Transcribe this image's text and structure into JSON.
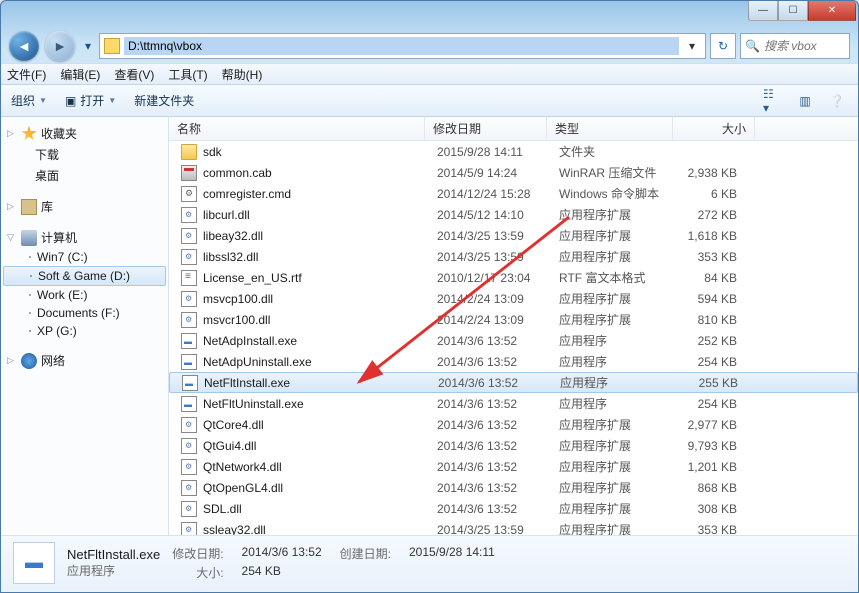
{
  "address_path": "D:\\ttmnq\\vbox",
  "search_placeholder": "搜索 vbox",
  "menu": {
    "file": "文件(F)",
    "edit": "编辑(E)",
    "view": "查看(V)",
    "tools": "工具(T)",
    "help": "帮助(H)"
  },
  "toolbar": {
    "organize": "组织",
    "open": "打开",
    "newfolder": "新建文件夹"
  },
  "sidebar": {
    "favorites": {
      "label": "收藏夹",
      "items": [
        {
          "label": "下载"
        },
        {
          "label": "桌面"
        }
      ]
    },
    "libraries": {
      "label": "库"
    },
    "computer": {
      "label": "计算机",
      "drives": [
        {
          "label": "Win7 (C:)"
        },
        {
          "label": "Soft & Game (D:)"
        },
        {
          "label": "Work (E:)"
        },
        {
          "label": "Documents (F:)"
        },
        {
          "label": "XP (G:)"
        }
      ]
    },
    "network": {
      "label": "网络"
    }
  },
  "columns": {
    "name": "名称",
    "date": "修改日期",
    "type": "类型",
    "size": "大小"
  },
  "files": [
    {
      "icon": "folder",
      "name": "sdk",
      "date": "2015/9/28 14:11",
      "type": "文件夹",
      "size": ""
    },
    {
      "icon": "cab",
      "name": "common.cab",
      "date": "2014/5/9 14:24",
      "type": "WinRAR 压缩文件",
      "size": "2,938 KB"
    },
    {
      "icon": "cmd",
      "name": "comregister.cmd",
      "date": "2014/12/24 15:28",
      "type": "Windows 命令脚本",
      "size": "6 KB"
    },
    {
      "icon": "dll",
      "name": "libcurl.dll",
      "date": "2014/5/12 14:10",
      "type": "应用程序扩展",
      "size": "272 KB"
    },
    {
      "icon": "dll",
      "name": "libeay32.dll",
      "date": "2014/3/25 13:59",
      "type": "应用程序扩展",
      "size": "1,618 KB"
    },
    {
      "icon": "dll",
      "name": "libssl32.dll",
      "date": "2014/3/25 13:59",
      "type": "应用程序扩展",
      "size": "353 KB"
    },
    {
      "icon": "rtf",
      "name": "License_en_US.rtf",
      "date": "2010/12/17 23:04",
      "type": "RTF 富文本格式",
      "size": "84 KB"
    },
    {
      "icon": "dll",
      "name": "msvcp100.dll",
      "date": "2014/2/24 13:09",
      "type": "应用程序扩展",
      "size": "594 KB"
    },
    {
      "icon": "dll",
      "name": "msvcr100.dll",
      "date": "2014/2/24 13:09",
      "type": "应用程序扩展",
      "size": "810 KB"
    },
    {
      "icon": "exe",
      "name": "NetAdpInstall.exe",
      "date": "2014/3/6 13:52",
      "type": "应用程序",
      "size": "252 KB"
    },
    {
      "icon": "exe",
      "name": "NetAdpUninstall.exe",
      "date": "2014/3/6 13:52",
      "type": "应用程序",
      "size": "254 KB"
    },
    {
      "icon": "exe",
      "name": "NetFltInstall.exe",
      "date": "2014/3/6 13:52",
      "type": "应用程序",
      "size": "255 KB",
      "selected": true
    },
    {
      "icon": "exe",
      "name": "NetFltUninstall.exe",
      "date": "2014/3/6 13:52",
      "type": "应用程序",
      "size": "254 KB"
    },
    {
      "icon": "dll",
      "name": "QtCore4.dll",
      "date": "2014/3/6 13:52",
      "type": "应用程序扩展",
      "size": "2,977 KB"
    },
    {
      "icon": "dll",
      "name": "QtGui4.dll",
      "date": "2014/3/6 13:52",
      "type": "应用程序扩展",
      "size": "9,793 KB"
    },
    {
      "icon": "dll",
      "name": "QtNetwork4.dll",
      "date": "2014/3/6 13:52",
      "type": "应用程序扩展",
      "size": "1,201 KB"
    },
    {
      "icon": "dll",
      "name": "QtOpenGL4.dll",
      "date": "2014/3/6 13:52",
      "type": "应用程序扩展",
      "size": "868 KB"
    },
    {
      "icon": "dll",
      "name": "SDL.dll",
      "date": "2014/3/6 13:52",
      "type": "应用程序扩展",
      "size": "308 KB"
    },
    {
      "icon": "dll",
      "name": "ssleay32.dll",
      "date": "2014/3/25 13:59",
      "type": "应用程序扩展",
      "size": "353 KB"
    }
  ],
  "details": {
    "name": "NetFltInstall.exe",
    "type": "应用程序",
    "mod_label": "修改日期:",
    "mod_value": "2014/3/6 13:52",
    "size_label": "大小:",
    "size_value": "254 KB",
    "create_label": "创建日期:",
    "create_value": "2015/9/28 14:11"
  },
  "annotation_arrow": {
    "color": "#e03030"
  }
}
